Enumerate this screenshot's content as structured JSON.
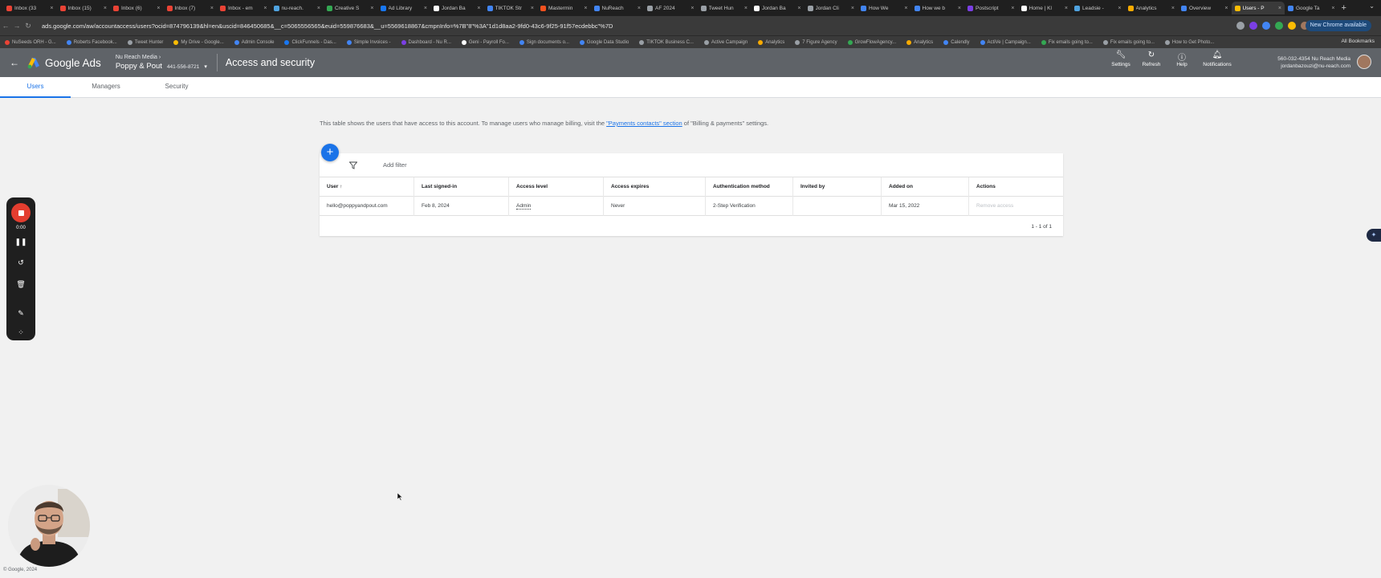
{
  "browser": {
    "tabs": [
      {
        "title": "Inbox (33",
        "color": "#ea4335"
      },
      {
        "title": "Inbox (15)",
        "color": "#ea4335"
      },
      {
        "title": "Inbox (6)",
        "color": "#ea4335"
      },
      {
        "title": "Inbox (7)",
        "color": "#ea4335"
      },
      {
        "title": "Inbox - em",
        "color": "#ea4335"
      },
      {
        "title": "nu-reach.",
        "color": "#4fa3e0"
      },
      {
        "title": "Creative S",
        "color": "#34a853"
      },
      {
        "title": "Ad Library",
        "color": "#1877f2"
      },
      {
        "title": "Jordan Ba",
        "color": "#ffffff"
      },
      {
        "title": "TIKTOK Str",
        "color": "#4285f4"
      },
      {
        "title": "Mastermin",
        "color": "#f4511e"
      },
      {
        "title": "NuReach",
        "color": "#4285f4"
      },
      {
        "title": "AF 2024",
        "color": "#9aa0a6"
      },
      {
        "title": "Tweet Hun",
        "color": "#9aa0a6"
      },
      {
        "title": "Jordan Ba",
        "color": "#ffffff"
      },
      {
        "title": "Jordan Cli",
        "color": "#9aa0a6"
      },
      {
        "title": "How We",
        "color": "#4285f4"
      },
      {
        "title": "How we b",
        "color": "#4285f4"
      },
      {
        "title": "Postscript",
        "color": "#7b3fe4"
      },
      {
        "title": "Home | Kl",
        "color": "#ffffff"
      },
      {
        "title": "Leadsie -",
        "color": "#4fa3e0"
      },
      {
        "title": "Analytics",
        "color": "#f9ab00"
      },
      {
        "title": "Overview",
        "color": "#4285f4"
      },
      {
        "title": "Users - P",
        "color": "#fbbc04"
      },
      {
        "title": "Google Ta",
        "color": "#4285f4"
      }
    ],
    "active_tab_index": 23,
    "new_tab": "+",
    "url": "ads.google.com/aw/accountaccess/users?ocid=874796139&hl=en&uscid=846450685&__c=5065556565&euid=559876683&__u=5569618867&cmpnInfo=%7B\"8\"%3A\"1d1d8aa2-9fd0-43c6-9f25-91f57ecdebbc\"%7D",
    "update_button": "New Chrome available",
    "bookmarks": [
      "NuSeeds ORH - G...",
      "Roberts Facebook...",
      "Tweet Hunter",
      "My Drive - Google...",
      "Admin Console",
      "ClickFunnels - Das...",
      "Simple Invoices -",
      "Dashboard - Nu R...",
      "Geni - Payroll Fo...",
      "Sign documents o...",
      "Google Data Studio",
      "TIKTOK Business C...",
      "Active Campaign",
      "Analytics",
      "7 Figure Agency",
      "GrowFlowAgency...",
      "Analytics",
      "Calendly",
      "ActiVe | Campaign...",
      "Fix emails going to...",
      "Fix emails going to...",
      "How to Get Photo..."
    ],
    "all_bookmarks": "All Bookmarks"
  },
  "header": {
    "product": "Google Ads",
    "manager_account": "Nu Reach Media",
    "account_name": "Poppy & Pout",
    "customer_id": "441-556-8721",
    "page_title": "Access and security",
    "actions": [
      {
        "label": "Settings",
        "icon": "wrench-icon"
      },
      {
        "label": "Refresh",
        "icon": "refresh-icon"
      },
      {
        "label": "Help",
        "icon": "help-icon"
      },
      {
        "label": "Notifications",
        "icon": "bell-icon"
      }
    ],
    "user_line1": "560-032-4354 Nu Reach Media",
    "user_line2": "jordanbazouzi@nu-reach.com"
  },
  "tabs": [
    "Users",
    "Managers",
    "Security"
  ],
  "active_tab": "Users",
  "info": {
    "before": "This table shows the users that have access to this account. To manage users who manage billing, visit the ",
    "link": "\"Payments contacts\" section",
    "after": " of \"Billing & payments\" settings."
  },
  "filter": {
    "add_filter": "Add filter"
  },
  "table": {
    "columns": [
      "User",
      "Last signed-in",
      "Access level",
      "Access expires",
      "Authentication method",
      "Invited by",
      "Added on",
      "Actions"
    ],
    "sort_indicator": "↑",
    "rows": [
      [
        "hello@poppyandpout.com",
        "Feb 8, 2024",
        "Admin",
        "Never",
        "2-Step Verification",
        "",
        "Mar 15, 2022",
        "Remove access"
      ]
    ],
    "pagination": "1 - 1 of 1"
  },
  "recorder": {
    "time": "0:00"
  },
  "footer": "© Google, 2024",
  "colors": {
    "accent": "#1a73e8",
    "record": "#e33d2f",
    "header_bg": "#5f6368"
  }
}
